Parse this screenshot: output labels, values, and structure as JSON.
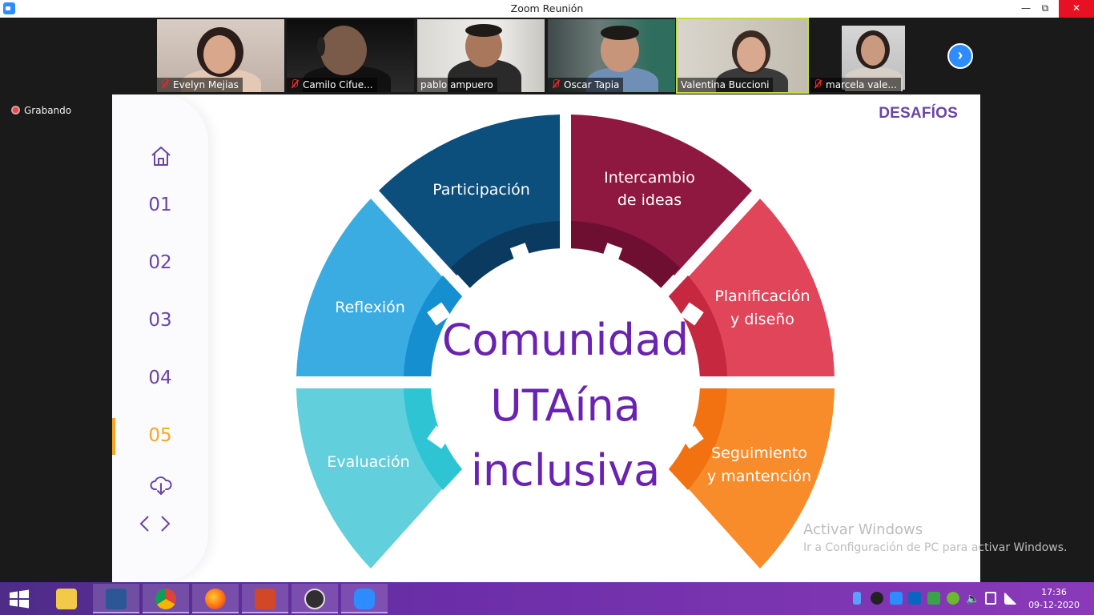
{
  "window": {
    "title": "Zoom Reunión"
  },
  "participants": [
    {
      "name": "Evelyn Mejias",
      "muted": true
    },
    {
      "name": "Camilo Cifue...",
      "muted": true
    },
    {
      "name": "pablo ampuero",
      "muted": false
    },
    {
      "name": "Oscar Tapia",
      "muted": true
    },
    {
      "name": "Valentina Buccioni",
      "muted": false
    },
    {
      "name": "marcela vale...",
      "muted": true
    }
  ],
  "recording": {
    "label": "Grabando"
  },
  "slide": {
    "heading": "DESAFÍOS",
    "nav": [
      "01",
      "02",
      "03",
      "04",
      "05"
    ],
    "nav_active": "05",
    "segments": {
      "participacion": [
        "Participación"
      ],
      "intercambio": [
        "Intercambio",
        "de ideas"
      ],
      "planificacion": [
        "Planificación",
        "y diseño"
      ],
      "seguimiento": [
        "Seguimiento",
        "y mantención"
      ],
      "evaluacion": [
        "Evaluación"
      ],
      "reflexion": [
        "Reflexión"
      ]
    },
    "center": [
      "Comunidad",
      "UTAína",
      "inclusiva"
    ],
    "colors": {
      "participacion": "#0d4f7c",
      "intercambio": "#8e1840",
      "planificacion": "#e0455a",
      "seguimiento": "#f88c2a",
      "evaluacion": "#62cfdc",
      "reflexion": "#3aace2",
      "center_text": "#6a22b0"
    }
  },
  "watermark": {
    "line1": "Activar Windows",
    "line2": "Ir a Configuración de PC para activar Windows."
  },
  "taskbar": {
    "time": "17:36",
    "date": "09-12-2020"
  }
}
